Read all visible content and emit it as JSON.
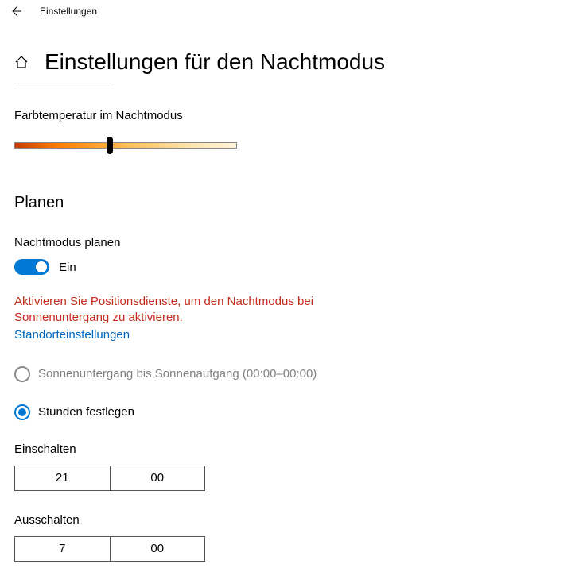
{
  "header": {
    "title": "Einstellungen"
  },
  "page": {
    "title": "Einstellungen für den Nachtmodus"
  },
  "colorTemp": {
    "label": "Farbtemperatur im Nachtmodus",
    "value_percent": 43
  },
  "schedule": {
    "heading": "Planen",
    "planLabel": "Nachtmodus planen",
    "toggleState": "Ein",
    "toggleOn": true,
    "warning": "Aktivieren Sie Positionsdienste, um den Nachtmodus bei Sonnenuntergang zu aktivieren.",
    "locationLink": "Standorteinstellungen",
    "options": {
      "sunset": "Sonnenuntergang bis Sonnenaufgang (00:00–00:00)",
      "hours": "Stunden festlegen"
    },
    "turnOn": {
      "label": "Einschalten",
      "hour": "21",
      "minute": "00"
    },
    "turnOff": {
      "label": "Ausschalten",
      "hour": "7",
      "minute": "00"
    }
  }
}
